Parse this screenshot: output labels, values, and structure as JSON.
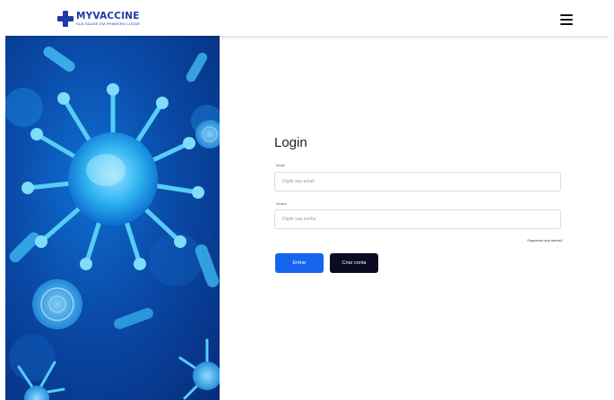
{
  "header": {
    "brand": "MYVACCINE",
    "brand_sub": "SUA SAÚDE EM PRIMEIRO LUGAR",
    "logo_icon": "medical-cross-icon",
    "menu_icon": "hamburger-menu-icon"
  },
  "hero": {
    "image": "virus-illustration"
  },
  "login": {
    "title": "Login",
    "email_label": "email",
    "email_placeholder": "Digite seu email",
    "password_label": "Senha",
    "password_placeholder": "Digite sua senha",
    "forgot_password": "Esqueceu sua senha?",
    "submit_label": "Entrar",
    "create_account_label": "Criar conta"
  },
  "colors": {
    "brand": "#1f3aa8",
    "primary_button": "#1565f0",
    "dark_button": "#0b0b22",
    "hero_blue": "#0a4aa8"
  }
}
